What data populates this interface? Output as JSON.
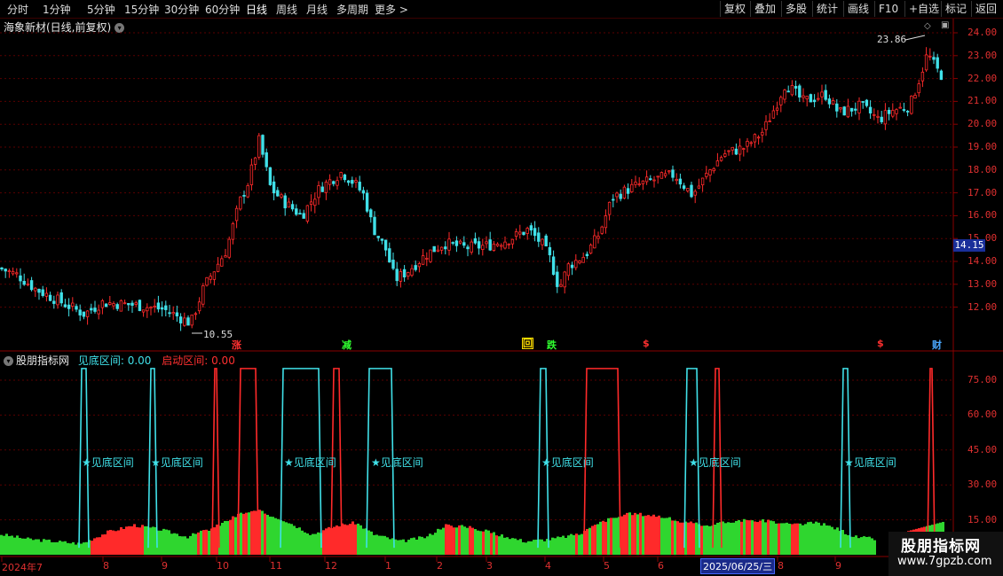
{
  "toolbar": {
    "periods": [
      "分时",
      "1分钟",
      "5分钟",
      "15分钟",
      "30分钟",
      "60分钟",
      "日线",
      "周线",
      "月线",
      "多周期",
      "更多"
    ],
    "more_arrow": ">",
    "right_buttons": [
      "复权",
      "叠加",
      "多股",
      "统计",
      "画线",
      "F10",
      "+自选",
      "标记",
      "返回"
    ]
  },
  "stock": {
    "title": "海象新材(日线,前复权)"
  },
  "price_axis": [
    "24.00",
    "23.00",
    "22.00",
    "21.00",
    "20.00",
    "19.00",
    "18.00",
    "17.00",
    "16.00",
    "15.00",
    "14.00",
    "13.00",
    "12.00"
  ],
  "price_tag": "14.15",
  "annotations": {
    "high": "23.86",
    "low": "10.55"
  },
  "signals": [
    {
      "text": "涨",
      "color": "#ff3030"
    },
    {
      "text": "减",
      "color": "#30ff30"
    },
    {
      "text": "回",
      "color": "#ffdd00"
    },
    {
      "text": "跌",
      "color": "#30ff30"
    },
    {
      "text": "$",
      "color": "#ff3030"
    },
    {
      "text": "$",
      "color": "#ff3030"
    },
    {
      "text": "财",
      "color": "#4aa8ff"
    }
  ],
  "indicator": {
    "name": "股朋指标网",
    "line1_label": "见底区间: 0.00",
    "line2_label": "启动区间: 0.00",
    "axis": [
      "75.00",
      "60.00",
      "45.00",
      "30.00",
      "15.00"
    ],
    "zone_text": "★见底区间"
  },
  "dates": [
    "2024年7",
    "8",
    "9",
    "10",
    "11",
    "12",
    "1",
    "2",
    "3",
    "4",
    "5",
    "6",
    "2025/06/25/三",
    "8",
    "9"
  ],
  "watermark": {
    "line1": "股朋指标网",
    "line2": "www.7gpzb.com"
  },
  "colors": {
    "up": "#ff2a2a",
    "down": "#2fd62f",
    "cyan": "#40e0e8",
    "axis": "#e03030",
    "grid": "#5a0000"
  }
}
